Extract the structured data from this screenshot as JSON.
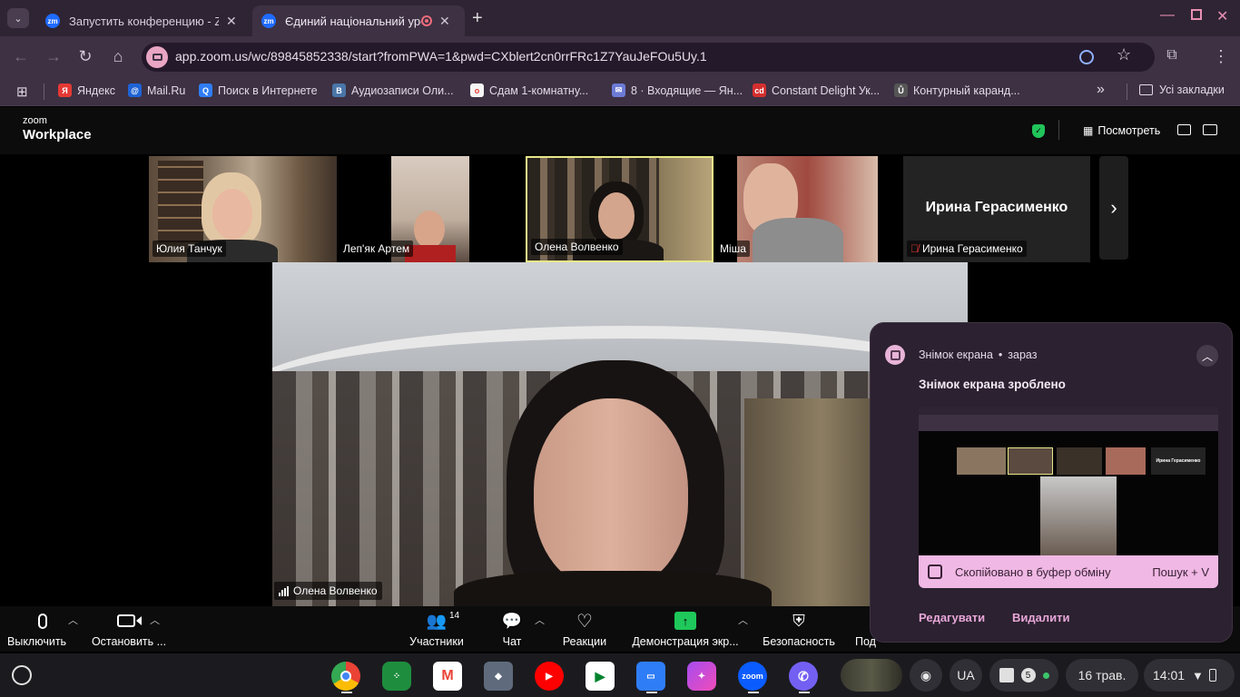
{
  "browser": {
    "tabs": [
      {
        "title": "Запустить конференцию - Zoom",
        "active": false
      },
      {
        "title": "Єдиний національний урок",
        "active": true
      }
    ],
    "url": "app.zoom.us/wc/89845852338/start?fromPWA=1&pwd=CXblert2cn0rrFRc1Z7YauJeFOu5Uy.1",
    "bookmarks": [
      {
        "label": "Яндекс",
        "icon": "Я",
        "color": "#e53935"
      },
      {
        "label": "Mail.Ru",
        "icon": "@",
        "color": "#1e63d6"
      },
      {
        "label": "Поиск в Интернете",
        "icon": "Q",
        "color": "#2f7df6"
      },
      {
        "label": "Аудиозаписи Оли...",
        "icon": "B",
        "color": "#4a76a8"
      },
      {
        "label": "Сдам 1-комнатну...",
        "icon": "o",
        "color": "#f5f5f5"
      },
      {
        "label": "8 · Входящие — Ян...",
        "icon": "✉",
        "color": "#6c7bd6"
      },
      {
        "label": "Constant Delight Ук...",
        "icon": "cd",
        "color": "#d32f2f"
      },
      {
        "label": "Контурный каранд...",
        "icon": "Ů",
        "color": "#555555"
      }
    ],
    "bookmarks_more": "»",
    "all_bookmarks": "Усі закладки"
  },
  "zoom": {
    "logo_top": "zoom",
    "logo_bottom": "Workplace",
    "view_label": "Посмотреть",
    "participants": [
      {
        "name": "Юлия Танчук"
      },
      {
        "name": "Леп'як Артем"
      },
      {
        "name": "Олена Волвенко"
      },
      {
        "name": "Міша"
      },
      {
        "name": "Ирина Герасименко",
        "big_name": "Ирина Герасименко",
        "muted": true
      }
    ],
    "speaker_name": "Олена Волвенко",
    "toolbar": {
      "mute": "Выключить ...",
      "video": "Остановить ...",
      "participants": "Участники",
      "participants_count": "14",
      "chat": "Чат",
      "reactions": "Реакции",
      "share": "Демонстрация экр...",
      "security": "Безопасность",
      "more": "Под"
    }
  },
  "notification": {
    "source": "Знімок екрана",
    "time": "зараз",
    "title": "Знімок екрана зроблено",
    "copied": "Скопійовано в буфер обміну",
    "shortcut": "Пошук + V",
    "edit": "Редагувати",
    "delete": "Видалити",
    "mini_name": "Ирина Герасименко"
  },
  "shelf": {
    "zoom_label": "zoom",
    "lang": "UA",
    "notif_count": "5",
    "date": "16 трав.",
    "time": "14:01"
  }
}
